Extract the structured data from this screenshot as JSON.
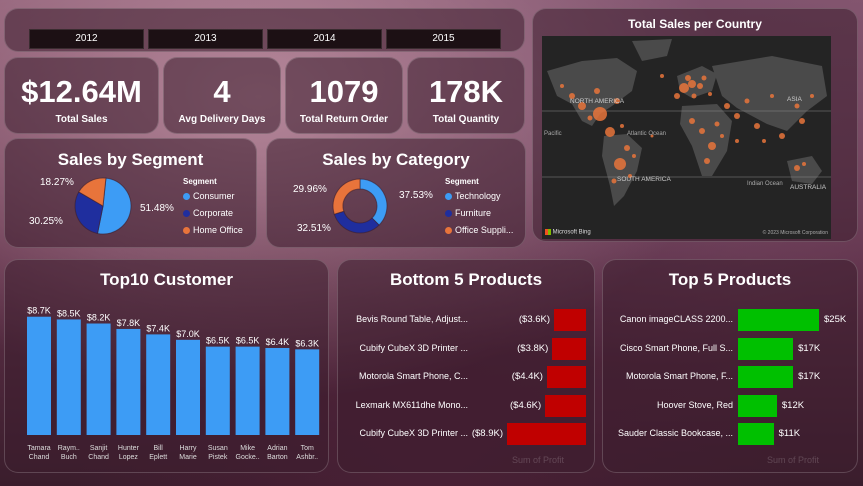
{
  "years": [
    "2012",
    "2013",
    "2014",
    "2015"
  ],
  "kpis": [
    {
      "value": "$12.64M",
      "label": "Total Sales"
    },
    {
      "value": "4",
      "label": "Avg Delivery Days"
    },
    {
      "value": "1079",
      "label": "Total Return Order"
    },
    {
      "value": "178K",
      "label": "Total Quantity"
    }
  ],
  "map": {
    "title": "Total Sales per Country",
    "labels": {
      "na": "NORTH AMERICA",
      "sa": "SOUTH AMERICA",
      "asia": "ASIA",
      "atlantic": "Atlantic Ocean",
      "indian": "Indian Ocean",
      "australia": "AUSTRALIA",
      "pacific": "Pacific"
    },
    "brand": "Microsoft Bing",
    "copyright": "© 2023 Microsoft Corporation"
  },
  "colors": {
    "blue": "#3d9cf5",
    "navy": "#1f2e9e",
    "orange": "#e8743b",
    "red": "#c00000",
    "green": "#00c000"
  },
  "chart_data": [
    {
      "type": "pie",
      "title": "Sales by Segment",
      "legend_title": "Segment",
      "categories": [
        "Consumer",
        "Corporate",
        "Home Office"
      ],
      "values": [
        51.48,
        30.25,
        18.27
      ],
      "labels": [
        "51.48%",
        "30.25%",
        "18.27%"
      ]
    },
    {
      "type": "pie",
      "title": "Sales by Category",
      "legend_title": "Segment",
      "categories": [
        "Technology",
        "Furniture",
        "Office Suppli..."
      ],
      "values": [
        37.53,
        32.51,
        29.96
      ],
      "labels": [
        "37.53%",
        "32.51%",
        "29.96%"
      ]
    },
    {
      "type": "bar",
      "title": "Top10 Customer",
      "categories": [
        "Tamara Chand",
        "Raymond Buch",
        "Sanjit Chand",
        "Hunter Lopez",
        "Bill Eplett",
        "Harry Marie",
        "Susan Pistek",
        "Mike Gockenbach",
        "Adrian Barton",
        "Tom Ashbrook"
      ],
      "cat_lines": [
        [
          "Tamara",
          "Chand"
        ],
        [
          "Raym..",
          "Buch"
        ],
        [
          "Sanjit",
          "Chand"
        ],
        [
          "Hunter",
          "Lopez"
        ],
        [
          "Bill",
          "Eplett"
        ],
        [
          "Harry",
          "Marie"
        ],
        [
          "Susan",
          "Pistek"
        ],
        [
          "Mike",
          "Gocke.."
        ],
        [
          "Adrian",
          "Barton"
        ],
        [
          "Tom",
          "Ashbr.."
        ]
      ],
      "values": [
        8.7,
        8.5,
        8.2,
        7.8,
        7.4,
        7.0,
        6.5,
        6.5,
        6.4,
        6.3
      ],
      "labels": [
        "$8.7K",
        "$8.5K",
        "$8.2K",
        "$7.8K",
        "$7.4K",
        "$7.0K",
        "$6.5K",
        "$6.5K",
        "$6.4K",
        "$6.3K"
      ],
      "ylim": [
        0,
        9.2
      ]
    },
    {
      "type": "bar",
      "title": "Bottom 5 Products",
      "xlabel": "Sum of Profit",
      "categories": [
        "Bevis Round Table, Adjust...",
        "Cubify CubeX 3D Printer ...",
        "Motorola Smart Phone, C...",
        "Lexmark MX611dhe Mono...",
        "Cubify CubeX 3D Printer ..."
      ],
      "values": [
        -3.6,
        -3.8,
        -4.4,
        -4.6,
        -8.9
      ],
      "labels": [
        "($3.6K)",
        "($3.8K)",
        "($4.4K)",
        "($4.6K)",
        "($8.9K)"
      ]
    },
    {
      "type": "bar",
      "title": "Top 5 Products",
      "xlabel": "Sum of Profit",
      "categories": [
        "Canon imageCLASS 2200...",
        "Cisco Smart Phone, Full S...",
        "Motorola Smart Phone, F...",
        "Hoover Stove, Red",
        "Sauder Classic Bookcase, ..."
      ],
      "values": [
        25,
        17,
        17,
        12,
        11
      ],
      "labels": [
        "$25K",
        "$17K",
        "$17K",
        "$12K",
        "$11K"
      ]
    }
  ]
}
